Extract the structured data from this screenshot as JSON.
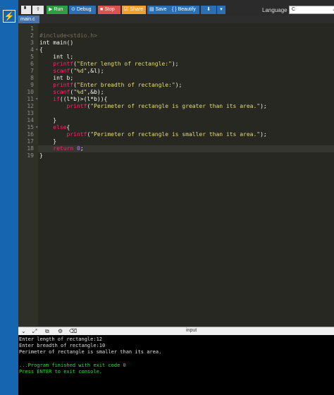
{
  "toolbar": {
    "new_icon": "new-file-icon",
    "upload_icon": "upload-icon",
    "run": "Run",
    "debug": "Debug",
    "stop": "Stop",
    "share": "Share",
    "save": "Save",
    "beautify": "{ } Beautify",
    "download_icon": "download-icon",
    "language_label": "Language",
    "language_value": "C"
  },
  "tabs": [
    {
      "label": "main.c"
    }
  ],
  "editor": {
    "line_numbers": [
      "1",
      "2",
      "3",
      "4",
      "5",
      "6",
      "7",
      "8",
      "9",
      "10",
      "11",
      "12",
      "13",
      "14",
      "15",
      "16",
      "17",
      "18",
      "19"
    ],
    "lines": [
      "",
      "#include<stdio.h>",
      "int main()",
      "{",
      "    int l;",
      "    printf(\"Enter length of rectangle:\");",
      "    scanf(\"%d\",&l);",
      "    int b;",
      "    printf(\"Enter breadth of rectangle:\");",
      "    scanf(\"%d\",&b);",
      "    if((l*b)>(l*b)){",
      "        printf(\"Perimeter of rectangle is greater than its area.\");",
      "",
      "    }",
      "    else{",
      "        printf(\"Perimeter of rectangle is smaller than its area.\");",
      "    }",
      "    return 0;",
      "}"
    ]
  },
  "io": {
    "title": "input",
    "output": [
      "Enter length of rectangle:12",
      "Enter breadth of rectangle:10",
      "Perimeter of rectangle is smaller than its area.",
      "",
      "...Program finished with exit code 0",
      "Press ENTER to exit console."
    ]
  },
  "colors": {
    "rail": "#1565b0",
    "run": "#2e9e45",
    "stop": "#d9534f",
    "share": "#f0a030",
    "console_status": "#22e03c"
  }
}
